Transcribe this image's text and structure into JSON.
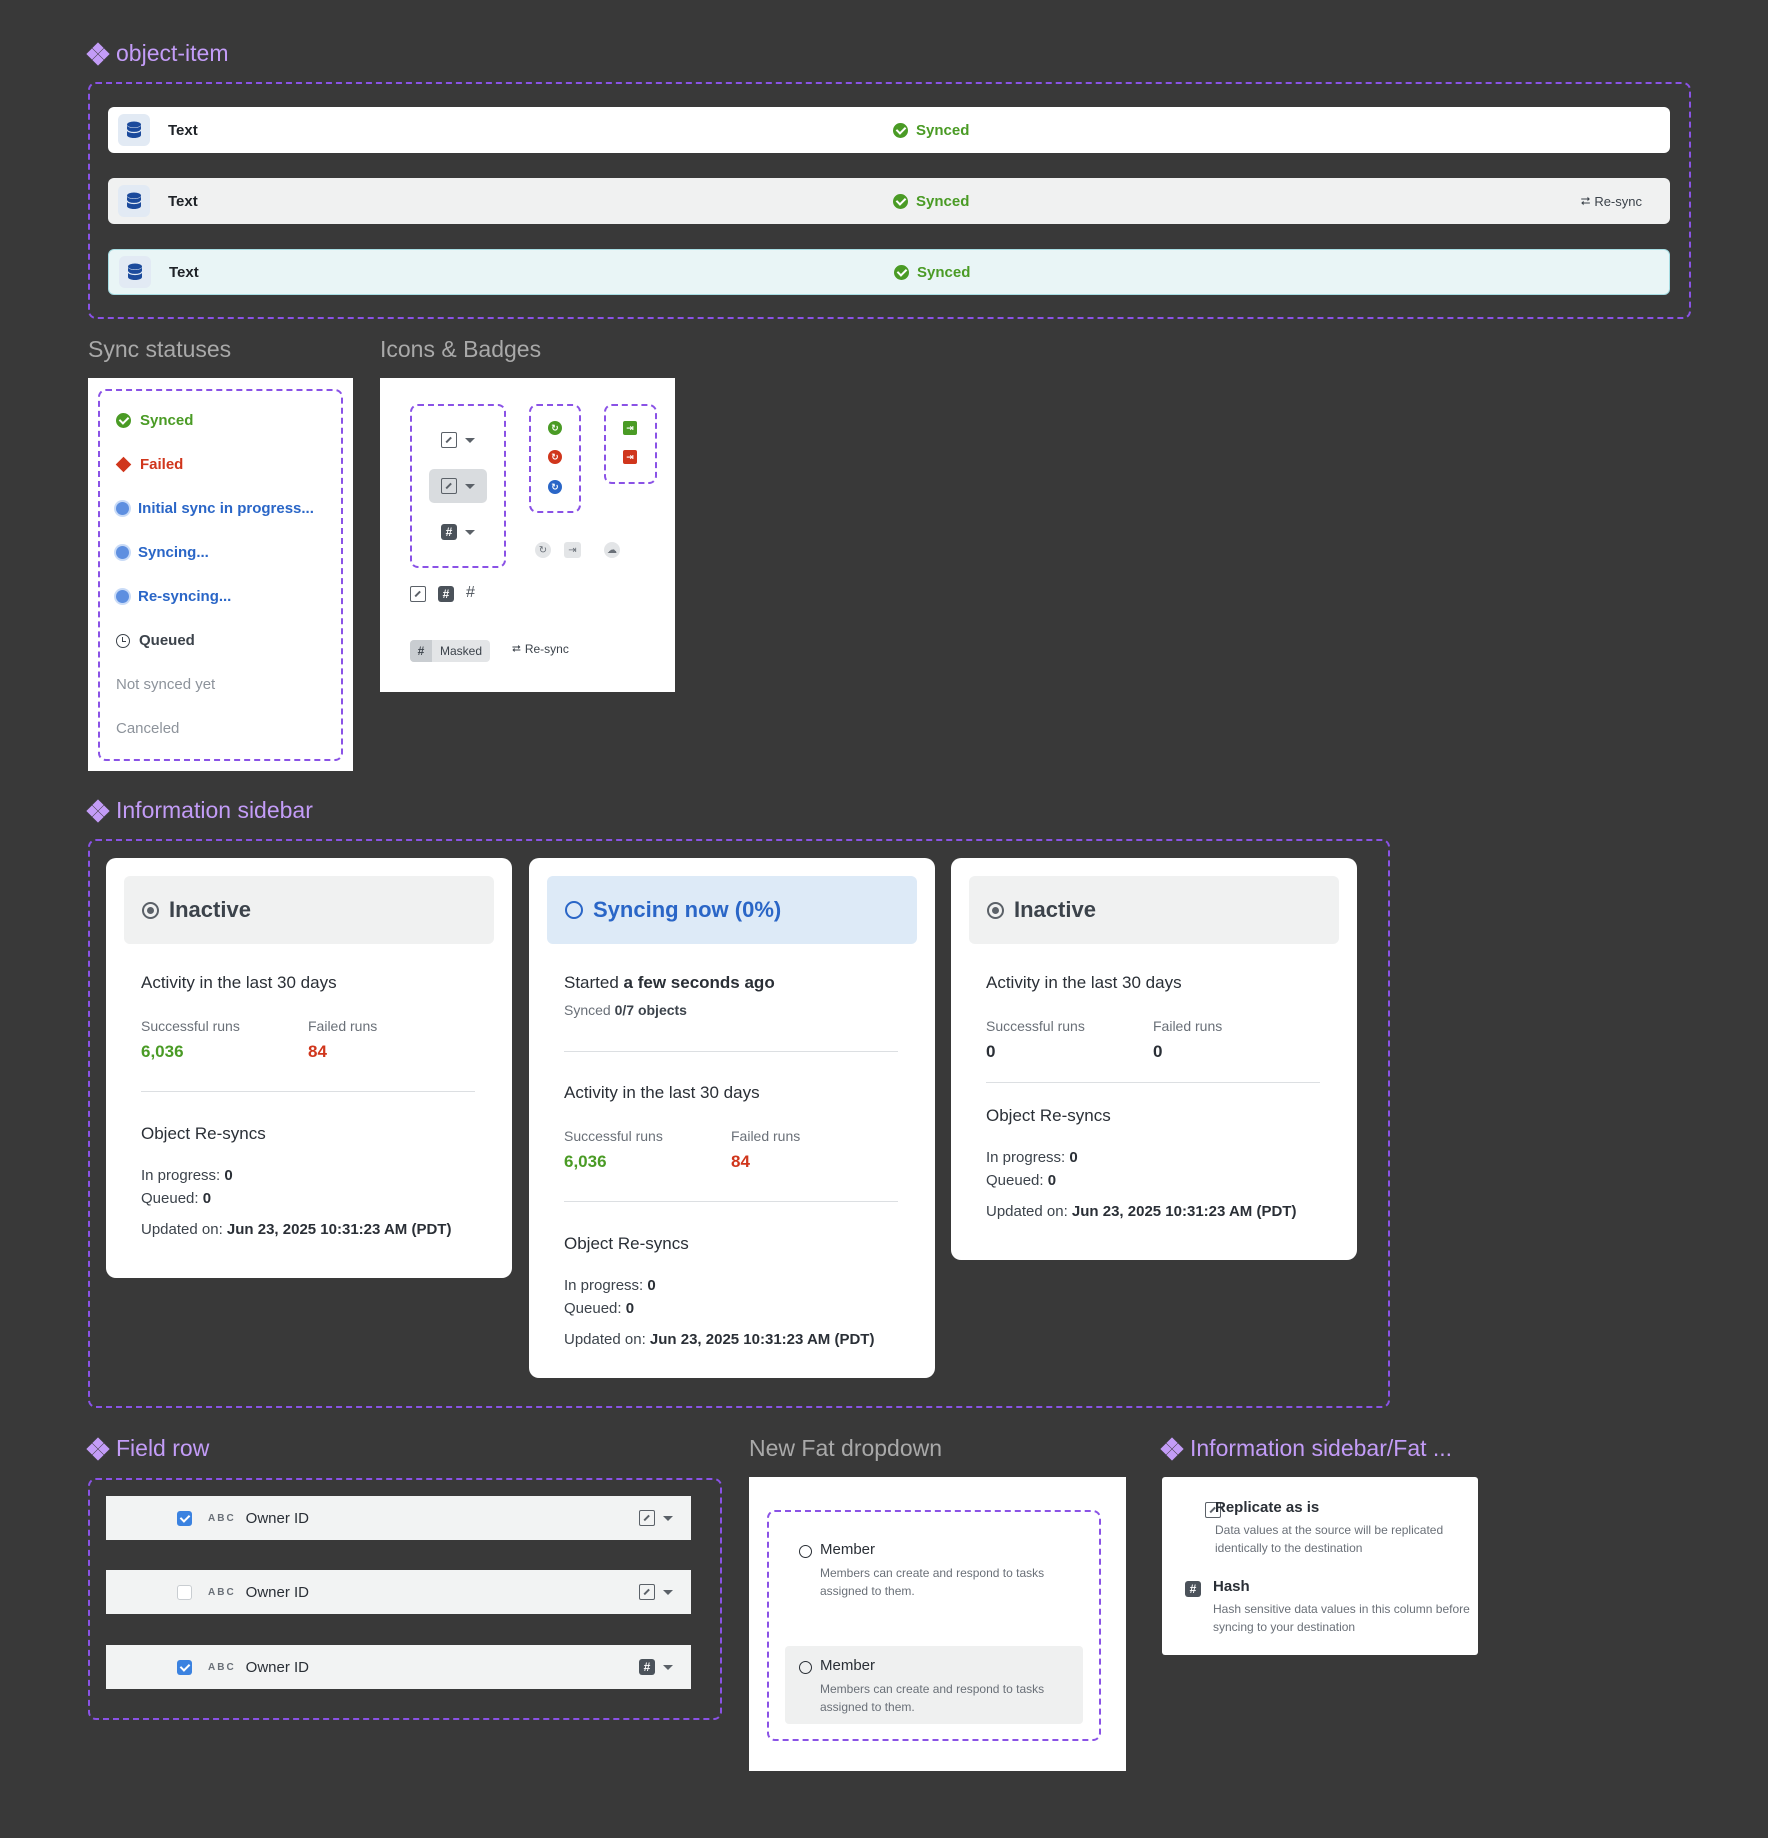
{
  "object_item": {
    "title": "object-item",
    "rows": [
      {
        "text": "Text",
        "status": "Synced"
      },
      {
        "text": "Text",
        "status": "Synced",
        "action": "Re-sync"
      },
      {
        "text": "Text",
        "status": "Synced"
      }
    ]
  },
  "sync_statuses": {
    "title": "Sync statuses",
    "items": [
      "Synced",
      "Failed",
      "Initial sync in progress...",
      "Syncing...",
      "Re-syncing...",
      "Queued",
      "Not synced yet",
      "Canceled"
    ]
  },
  "icons_badges": {
    "title": "Icons & Badges",
    "hash_glyph": "#",
    "masked_badge": "Masked",
    "resync_badge": "Re-sync"
  },
  "information_sidebar": {
    "title": "Information sidebar",
    "cards": [
      {
        "state": "Inactive",
        "activity_heading": "Activity in the last 30 days",
        "successful_label": "Successful runs",
        "successful_value": "6,036",
        "failed_label": "Failed runs",
        "failed_value": "84",
        "resyncs_heading": "Object Re-syncs",
        "in_progress_label": "In progress:",
        "in_progress_value": "0",
        "queued_label": "Queued:",
        "queued_value": "0",
        "updated_label": "Updated on:",
        "updated_value": "Jun 23, 2025 10:31:23 AM (PDT)"
      },
      {
        "state": "Syncing now (0%)",
        "started_label": "Started",
        "started_value": "a few seconds ago",
        "synced_label": "Synced",
        "synced_value": "0/7 objects",
        "activity_heading": "Activity in the last 30 days",
        "successful_label": "Successful runs",
        "successful_value": "6,036",
        "failed_label": "Failed runs",
        "failed_value": "84",
        "resyncs_heading": "Object Re-syncs",
        "in_progress_label": "In progress:",
        "in_progress_value": "0",
        "queued_label": "Queued:",
        "queued_value": "0",
        "updated_label": "Updated on:",
        "updated_value": "Jun 23, 2025 10:31:23 AM (PDT)"
      },
      {
        "state": "Inactive",
        "activity_heading": "Activity in the last 30 days",
        "successful_label": "Successful runs",
        "successful_value": "0",
        "failed_label": "Failed runs",
        "failed_value": "0",
        "resyncs_heading": "Object Re-syncs",
        "in_progress_label": "In progress:",
        "in_progress_value": "0",
        "queued_label": "Queued:",
        "queued_value": "0",
        "updated_label": "Updated on:",
        "updated_value": "Jun 23, 2025 10:31:23 AM (PDT)"
      }
    ]
  },
  "field_row": {
    "title": "Field row",
    "rows": [
      {
        "checked": true,
        "type": "ABC",
        "label": "Owner ID"
      },
      {
        "checked": false,
        "type": "ABC",
        "label": "Owner ID"
      },
      {
        "checked": true,
        "type": "ABC",
        "label": "Owner ID"
      }
    ]
  },
  "fat_dropdown": {
    "title": "New Fat dropdown",
    "options": [
      {
        "title": "Member",
        "desc": "Members can create and respond to tasks assigned to them."
      },
      {
        "title": "Member",
        "desc": "Members can create and respond to tasks assigned to them."
      }
    ]
  },
  "info_sidebar_fat": {
    "title": "Information sidebar/Fat ...",
    "items": [
      {
        "title": "Replicate as is",
        "desc": "Data values at the source will be replicated identically to the destination"
      },
      {
        "title": "Hash",
        "desc": "Hash sensitive data values in this column before syncing to your destination"
      }
    ]
  },
  "colors": {
    "background": "#393939",
    "accent_purple": "#8a52e6",
    "success": "#4a9b25",
    "error": "#d0361c",
    "info": "#2a66c7"
  }
}
